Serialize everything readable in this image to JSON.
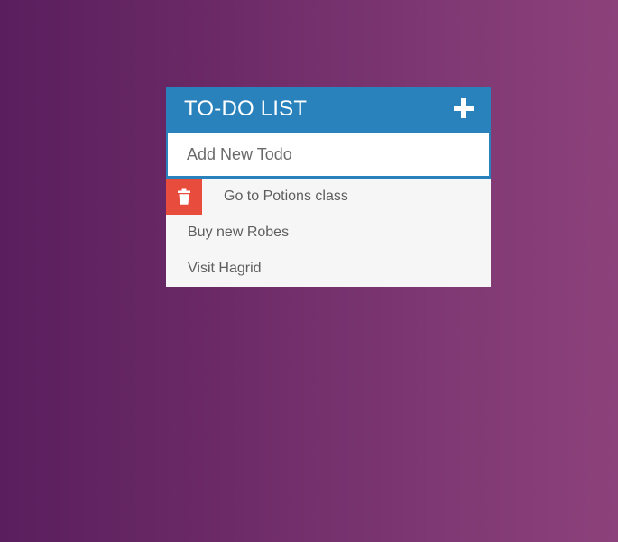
{
  "header": {
    "title": "TO-DO LIST",
    "add_icon": "plus-icon"
  },
  "input": {
    "placeholder": "Add New Todo",
    "value": ""
  },
  "todos": [
    {
      "text": "Go to Potions class",
      "hovered": true,
      "delete_icon": "trash-icon"
    },
    {
      "text": "Buy new Robes",
      "hovered": false
    },
    {
      "text": "Visit Hagrid",
      "hovered": false
    }
  ],
  "colors": {
    "header_bg": "#2a82bc",
    "delete_bg": "#e74c3c",
    "list_bg": "#f6f6f6",
    "background_start": "#5a1e5e",
    "background_end": "#8d417b"
  }
}
